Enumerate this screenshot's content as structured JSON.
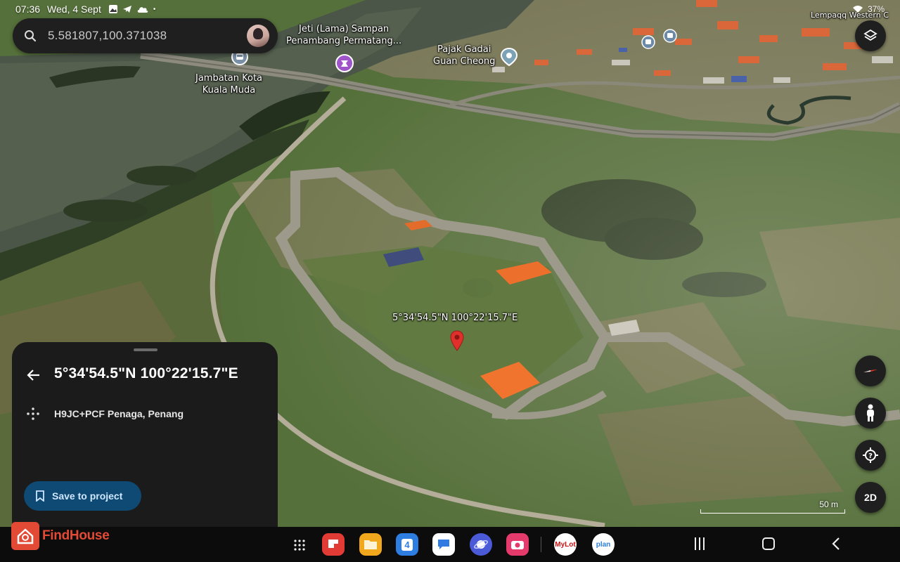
{
  "status_bar": {
    "time": "07:36",
    "date": "Wed, 4 Sept",
    "battery": "37%"
  },
  "search": {
    "query": "5.581807,100.371038"
  },
  "map_labels": {
    "bridge": "Jambatan Kota\nKuala Muda",
    "jetty": "Jeti (Lama) Sampan\nPenambang Permatang...",
    "pawnshop": "Pajak Gadai\nGuan Cheong",
    "area": "Lempaqq Western C",
    "marker_coords": "5°34'54.5\"N 100°22'15.7\"E"
  },
  "scale": {
    "label": "50 m"
  },
  "controls": {
    "view_mode": "2D"
  },
  "place_sheet": {
    "title": "5°34'54.5\"N 100°22'15.7\"E",
    "plus_code": "H9JC+PCF Penaga, Penang",
    "save_label": "Save to project"
  },
  "dock": {
    "brand": "FindHouse",
    "calendar_day": "4",
    "mylot_label": "MyLot",
    "plan_label": "plan"
  },
  "icons": {
    "accent_blue": "#0e4a74",
    "pin_red": "#e0302c"
  }
}
